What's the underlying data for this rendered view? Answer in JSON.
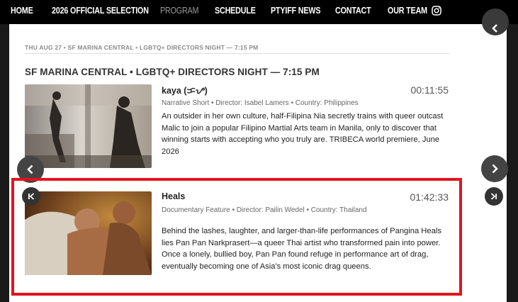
{
  "nav": {
    "items": [
      "HOME",
      "2026 OFFICIAL SELECTION",
      "PROGRAM",
      "SCHEDULE",
      "PTYIFF NEWS",
      "CONTACT",
      "OUR TEAM"
    ],
    "active_index": 2,
    "social_icon": "instagram-icon"
  },
  "program": {
    "date_line": "THU AUG 27  •  SF MARINA CENTRAL • LGBTQ+ DIRECTORS NIGHT — 7:15 PM",
    "event_title": "SF MARINA CENTRAL • LGBTQ+ DIRECTORS NIGHT — 7:15 PM",
    "films": [
      {
        "title": "kaya (ᜃᜌ)",
        "runtime": "00:11:55",
        "meta": "Narrative Short  •  Director: Isabel Lamers  •  Country: Philippines",
        "description": "An outsider in her own culture, half-Filipina Nia secretly trains with queer outcast Malic to join a popular Filipino Martial Arts team in Manila, only to discover that winning starts with accepting who you truly are. TRIBECA world premiere, June 2026"
      },
      {
        "title": "Heals",
        "runtime": "01:42:33",
        "meta": "Documentary Feature  •  Director: Pailin Wedel  •  Country: Thailand",
        "description": "Behind the lashes, laughter, and larger-than-life performances of Pangina Heals lies Pan Pan Narkprasert—a queer Thai artist who transformed pain into power. Once a lonely, bullied boy, Pan Pan found refuge in performance art of drag, eventually becoming one of Asia's most iconic drag queens."
      }
    ]
  },
  "colors": {
    "highlight": "#e2131e",
    "nav_bg": "#000000",
    "nav_active": "#9a9a9a"
  }
}
